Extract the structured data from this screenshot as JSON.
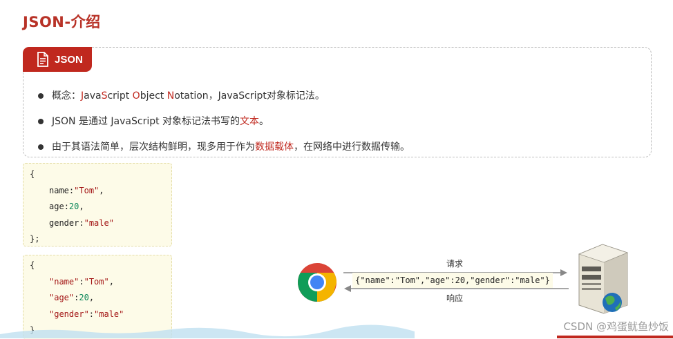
{
  "title": "JSON-介绍",
  "section_tag": {
    "label": "JSON",
    "icon": "document-icon"
  },
  "bullets": [
    {
      "parts": [
        {
          "text": "概念：",
          "red": false
        },
        {
          "text": "J",
          "red": true
        },
        {
          "text": "ava",
          "red": false
        },
        {
          "text": "S",
          "red": true
        },
        {
          "text": "cript ",
          "red": false
        },
        {
          "text": "O",
          "red": true
        },
        {
          "text": "bject ",
          "red": false
        },
        {
          "text": "N",
          "red": true
        },
        {
          "text": "otation，JavaScript对象标记法。",
          "red": false
        }
      ]
    },
    {
      "parts": [
        {
          "text": "JSON 是通过 JavaScript 对象标记法书写的",
          "red": false
        },
        {
          "text": "文本",
          "red": true
        },
        {
          "text": "。",
          "red": false
        }
      ]
    },
    {
      "parts": [
        {
          "text": "由于其语法简单，层次结构鲜明，现多用于作为",
          "red": false
        },
        {
          "text": "数据载体",
          "red": true
        },
        {
          "text": "，在网络中进行数据传输。",
          "red": false
        }
      ]
    }
  ],
  "code1": {
    "open": "{",
    "name_key": "name",
    "name_val": "\"Tom\"",
    "age_key": "age",
    "age_val": "20",
    "gender_key": "gender",
    "gender_val": "\"male\"",
    "close": "};"
  },
  "code2": {
    "open": "{",
    "name_key": "\"name\"",
    "name_val": "\"Tom\"",
    "age_key": "\"age\"",
    "age_val": "20",
    "gender_key": "\"gender\"",
    "gender_val": "\"male\"",
    "close": "}"
  },
  "diagram": {
    "request_label": "请求",
    "response_label": "响应",
    "payload": "{\"name\":\"Tom\",\"age\":20,\"gender\":\"male\"}",
    "client_icon": "chrome-browser-icon",
    "server_icon": "server-icon"
  },
  "watermark": "CSDN @鸡蛋鱿鱼炒饭",
  "colors": {
    "accent": "#c0281e",
    "title": "#b83227",
    "code_bg": "#fdfbe8"
  }
}
